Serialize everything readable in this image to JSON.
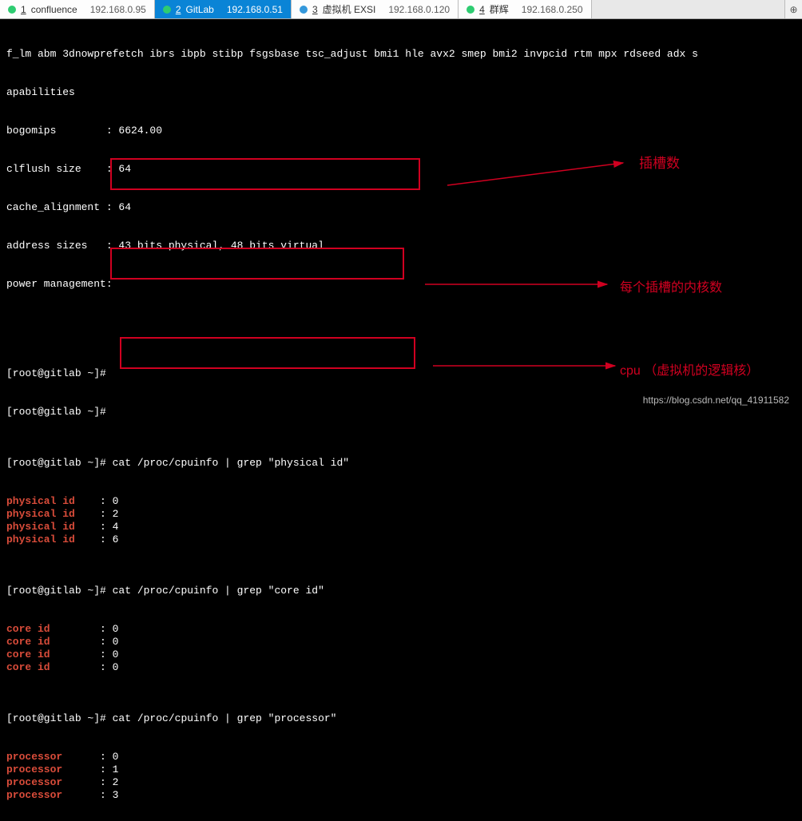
{
  "tabs": [
    {
      "num": "1",
      "title": "confluence",
      "ip": "192.168.0.95",
      "dot": "green",
      "active": false
    },
    {
      "num": "2",
      "title": "GitLab",
      "ip": "192.168.0.51",
      "dot": "green",
      "active": true
    },
    {
      "num": "3",
      "title": "虚拟机 EXSI",
      "ip": "192.168.0.120",
      "dot": "blue",
      "active": false
    },
    {
      "num": "4",
      "title": "群辉",
      "ip": "192.168.0.250",
      "dot": "green",
      "active": false
    }
  ],
  "cpuinfo_header": {
    "flags_line": "f_lm abm 3dnowprefetch ibrs ibpb stibp fsgsbase tsc_adjust bmi1 hle avx2 smep bmi2 invpcid rtm mpx rdseed adx s",
    "cap_line": "apabilities",
    "bogomips": "bogomips        : 6624.00",
    "clflush": "clflush size    : 64",
    "cache_align": "cache_alignment : 64",
    "address_sizes": "address sizes   : 43 bits physical, 48 bits virtual",
    "power_mgmt": "power management:"
  },
  "prompts": {
    "p1": "[root@gitlab ~]#",
    "p2": "[root@gitlab ~]#",
    "cmd1_prompt": "[root@gitlab ~]# ",
    "cmd1": "cat /proc/cpuinfo | grep \"physical id\"",
    "cmd2_prompt": "[root@gitlab ~]# ",
    "cmd2": "cat /proc/cpuinfo | grep \"core id\"",
    "cmd3_prompt": "[root@gitlab ~]# ",
    "cmd3": "cat /proc/cpuinfo | grep \"processor\""
  },
  "physical_id": [
    {
      "label": "physical id",
      "value": ": 0"
    },
    {
      "label": "physical id",
      "value": ": 2"
    },
    {
      "label": "physical id",
      "value": ": 4"
    },
    {
      "label": "physical id",
      "value": ": 6"
    }
  ],
  "core_id": [
    {
      "label": "core id",
      "value": ": 0"
    },
    {
      "label": "core id",
      "value": ": 0"
    },
    {
      "label": "core id",
      "value": ": 0"
    },
    {
      "label": "core id",
      "value": ": 0"
    }
  ],
  "processor": [
    {
      "label": "processor",
      "value": ": 0"
    },
    {
      "label": "processor",
      "value": ": 1"
    },
    {
      "label": "processor",
      "value": ": 2"
    },
    {
      "label": "processor",
      "value": ": 3"
    }
  ],
  "annotations": {
    "slots": "插槽数",
    "cores": "每个插槽的内核数",
    "cpu": "cpu （虚拟机的逻辑核）"
  },
  "watermark": "https://blog.csdn.net/qq_41911582"
}
